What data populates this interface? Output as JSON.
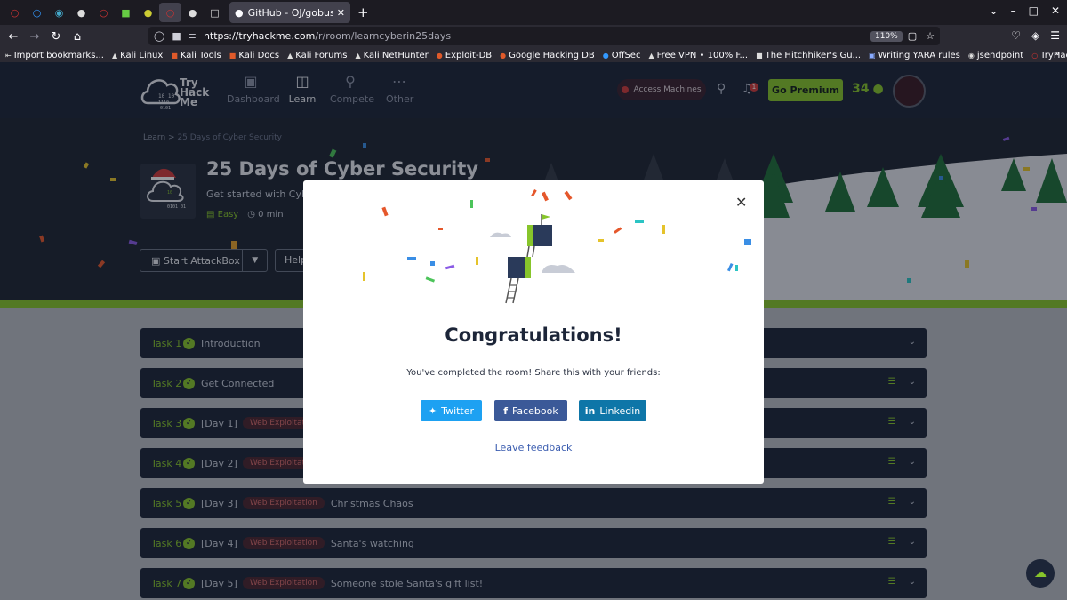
{
  "browser": {
    "tab_title": "GitHub - OJ/gobuster: Dir",
    "url_host": "https://tryhackme.com",
    "url_path": "/r/room/learncyberin25days",
    "zoom": "110%",
    "bookmarks": [
      "Import bookmarks...",
      "Kali Linux",
      "Kali Tools",
      "Kali Docs",
      "Kali Forums",
      "Kali NetHunter",
      "Exploit-DB",
      "Google Hacking DB",
      "OffSec",
      "Free VPN • 100% F...",
      "The Hitchhiker's Gu...",
      "Writing YARA rules",
      "jsendpoint",
      "TryHackMe | Linux ..."
    ]
  },
  "header": {
    "logo": "Try Hack Me",
    "nav": [
      "Dashboard",
      "Learn",
      "Compete",
      "Other"
    ],
    "access_machines": "Access Machines",
    "notifications": "1",
    "premium": "Go Premium",
    "streak": "34"
  },
  "room": {
    "breadcrumb_root": "Learn",
    "breadcrumb_sep": ">",
    "breadcrumb_current": "25 Days of Cyber Security",
    "title": "25 Days of Cyber Security",
    "description": "Get started with Cyber S",
    "difficulty": "Easy",
    "duration": "0 min",
    "attackbox": "Start AttackBox",
    "help": "Help"
  },
  "tasks": [
    {
      "num": "Task 1",
      "day": "",
      "tag": "",
      "name": "Introduction"
    },
    {
      "num": "Task 2",
      "day": "",
      "tag": "",
      "name": "Get Connected"
    },
    {
      "num": "Task 3",
      "day": "[Day 1]",
      "tag": "Web Exploitation",
      "name": ""
    },
    {
      "num": "Task 4",
      "day": "[Day 2]",
      "tag": "Web Exploitation",
      "name": ""
    },
    {
      "num": "Task 5",
      "day": "[Day 3]",
      "tag": "Web Exploitation",
      "name": "Christmas Chaos"
    },
    {
      "num": "Task 6",
      "day": "[Day 4]",
      "tag": "Web Exploitation",
      "name": "Santa's watching"
    },
    {
      "num": "Task 7",
      "day": "[Day 5]",
      "tag": "Web Exploitation",
      "name": "Someone stole Santa's gift list!"
    }
  ],
  "modal": {
    "title": "Congratulations!",
    "text": "You've completed the room! Share this with your friends:",
    "twitter": "Twitter",
    "facebook": "Facebook",
    "linkedin": "Linkedin",
    "feedback": "Leave feedback"
  },
  "colors": {
    "accent": "#87c52b",
    "navy": "#1c2538",
    "danger": "#d13c3c"
  }
}
